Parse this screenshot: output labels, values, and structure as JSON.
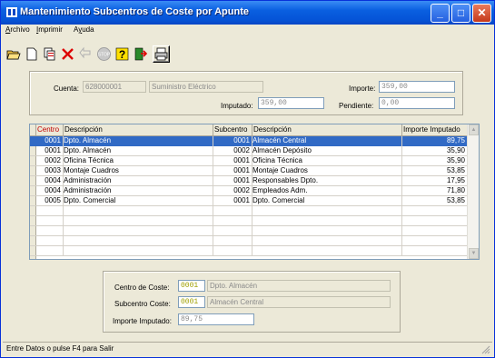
{
  "window": {
    "title": "Mantenimiento Subcentros de Coste por Apunte"
  },
  "menu": [
    "Archivo",
    "Imprimir",
    "Ayuda"
  ],
  "toolbar": {
    "buttons": [
      "open-icon",
      "new-icon",
      "copy-icon",
      "delete-icon",
      "back-icon",
      "stop-icon",
      "help-icon",
      "exit-icon",
      "print-icon"
    ]
  },
  "header": {
    "cuenta_label": "Cuenta:",
    "cuenta_code": "628000001",
    "cuenta_desc": "Suministro Eléctrico",
    "importe_label": "Importe:",
    "importe_value": "359,00",
    "imputado_label": "Imputado:",
    "imputado_value": "359,00",
    "pendiente_label": "Pendiente:",
    "pendiente_value": "0,00"
  },
  "grid": {
    "columns": [
      "Centro",
      "Descripción",
      "Subcentro",
      "Descripción",
      "Importe Imputado"
    ],
    "rows": [
      {
        "centro": "0001",
        "desc": "Dpto. Almacén",
        "subcentro": "0001",
        "subdesc": "Almacén Central",
        "importe": "89,75"
      },
      {
        "centro": "0001",
        "desc": "Dpto. Almacén",
        "subcentro": "0002",
        "subdesc": "Almacén Depósito",
        "importe": "35,90"
      },
      {
        "centro": "0002",
        "desc": "Oficina Técnica",
        "subcentro": "0001",
        "subdesc": "Oficina Técnica",
        "importe": "35,90"
      },
      {
        "centro": "0003",
        "desc": "Montaje Cuadros",
        "subcentro": "0001",
        "subdesc": "Montaje Cuadros",
        "importe": "53,85"
      },
      {
        "centro": "0004",
        "desc": "Administración",
        "subcentro": "0001",
        "subdesc": "Responsables Dpto.",
        "importe": "17,95"
      },
      {
        "centro": "0004",
        "desc": "Administración",
        "subcentro": "0002",
        "subdesc": "Empleados Adm.",
        "importe": "71,80"
      },
      {
        "centro": "0005",
        "desc": "Dpto. Comercial",
        "subcentro": "0001",
        "subdesc": "Dpto. Comercial",
        "importe": "53,85"
      }
    ]
  },
  "detail": {
    "centro_label": "Centro de Coste:",
    "centro_code": "0001",
    "centro_desc": "Dpto. Almacén",
    "subcentro_label": "Subcentro Coste:",
    "subcentro_code": "0001",
    "subcentro_desc": "Almacén Central",
    "importe_label": "Importe Imputado:",
    "importe_value": "89,75"
  },
  "status": {
    "text": "Entre Datos o pulse F4 para Salir"
  },
  "colors": {
    "title_bar": "#0554d7",
    "selection": "#316ac5",
    "face": "#ece9d8",
    "centro_header": "#c00000"
  }
}
